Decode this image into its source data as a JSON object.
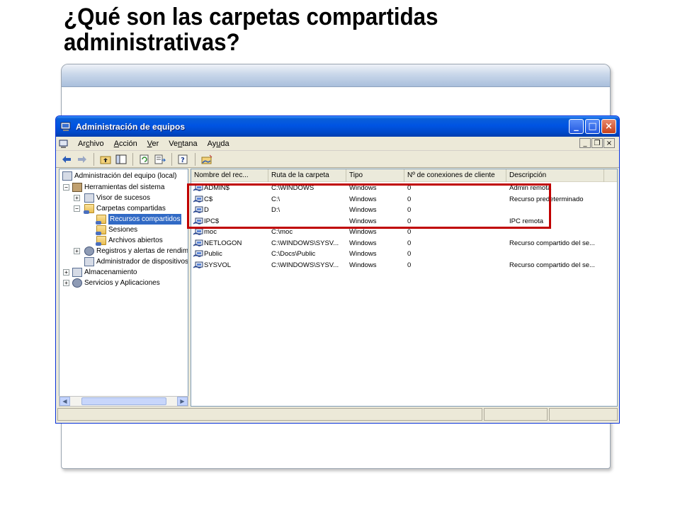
{
  "slide": {
    "title_line1": "¿Qué son las carpetas compartidas",
    "title_line2": "administrativas?"
  },
  "window": {
    "title": "Administración de equipos",
    "title_icon": "computer-management-icon",
    "buttons": {
      "minimize": "_",
      "maximize": "□",
      "close": "×"
    }
  },
  "menu": {
    "items": [
      {
        "pre": "Ar",
        "u": "c",
        "post": "hivo"
      },
      {
        "pre": "",
        "u": "A",
        "post": "cción"
      },
      {
        "pre": "",
        "u": "V",
        "post": "er"
      },
      {
        "pre": "Ve",
        "u": "n",
        "post": "tana"
      },
      {
        "pre": "Ay",
        "u": "u",
        "post": "da"
      }
    ],
    "mdi": {
      "minimize": "_",
      "restore": "❐",
      "close": "×"
    }
  },
  "toolbar": {
    "icons": [
      "back-arrow-icon",
      "forward-arrow-icon",
      "up-folder-icon",
      "show-tree-icon",
      "refresh-icon",
      "export-list-icon",
      "help-icon",
      "new-share-icon"
    ]
  },
  "tree": {
    "items": [
      {
        "label": "Administración del equipo (local)",
        "icon": "computer-icon"
      },
      {
        "label": "Herramientas del sistema",
        "icon": "tools-icon"
      },
      {
        "label": "Visor de sucesos",
        "icon": "event-viewer-icon"
      },
      {
        "label": "Carpetas compartidas",
        "icon": "shared-folder-icon"
      },
      {
        "label": "Recursos compartidos",
        "icon": "shared-folder-icon"
      },
      {
        "label": "Sesiones",
        "icon": "folder-icon"
      },
      {
        "label": "Archivos abiertos",
        "icon": "folder-icon"
      },
      {
        "label": "Registros y alertas de rendim",
        "icon": "performance-icon"
      },
      {
        "label": "Administrador de dispositivos",
        "icon": "device-manager-icon"
      },
      {
        "label": "Almacenamiento",
        "icon": "storage-icon"
      },
      {
        "label": "Servicios y Aplicaciones",
        "icon": "services-icon"
      }
    ],
    "selected_index": 4
  },
  "list": {
    "columns": [
      "Nombre del rec...",
      "Ruta de la carpeta",
      "Tipo",
      "Nº de conexiones de cliente",
      "Descripción"
    ],
    "rows": [
      [
        "ADMIN$",
        "C:\\WINDOWS",
        "Windows",
        "0",
        "Admin remota"
      ],
      [
        "C$",
        "C:\\",
        "Windows",
        "0",
        "Recurso predeterminado"
      ],
      [
        "D",
        "D:\\",
        "Windows",
        "0",
        ""
      ],
      [
        "IPC$",
        "",
        "Windows",
        "0",
        "IPC remota"
      ],
      [
        "moc",
        "C:\\moc",
        "Windows",
        "0",
        ""
      ],
      [
        "NETLOGON",
        "C:\\WINDOWS\\SYSV...",
        "Windows",
        "0",
        "Recurso compartido del se..."
      ],
      [
        "Public",
        "C:\\Docs\\Public",
        "Windows",
        "0",
        ""
      ],
      [
        "SYSVOL",
        "C:\\WINDOWS\\SYSV...",
        "Windows",
        "0",
        "Recurso compartido del se..."
      ]
    ]
  },
  "colors": {
    "highlight": "#c00000",
    "selection": "#316ac5",
    "titlebar": "#0054e3"
  }
}
